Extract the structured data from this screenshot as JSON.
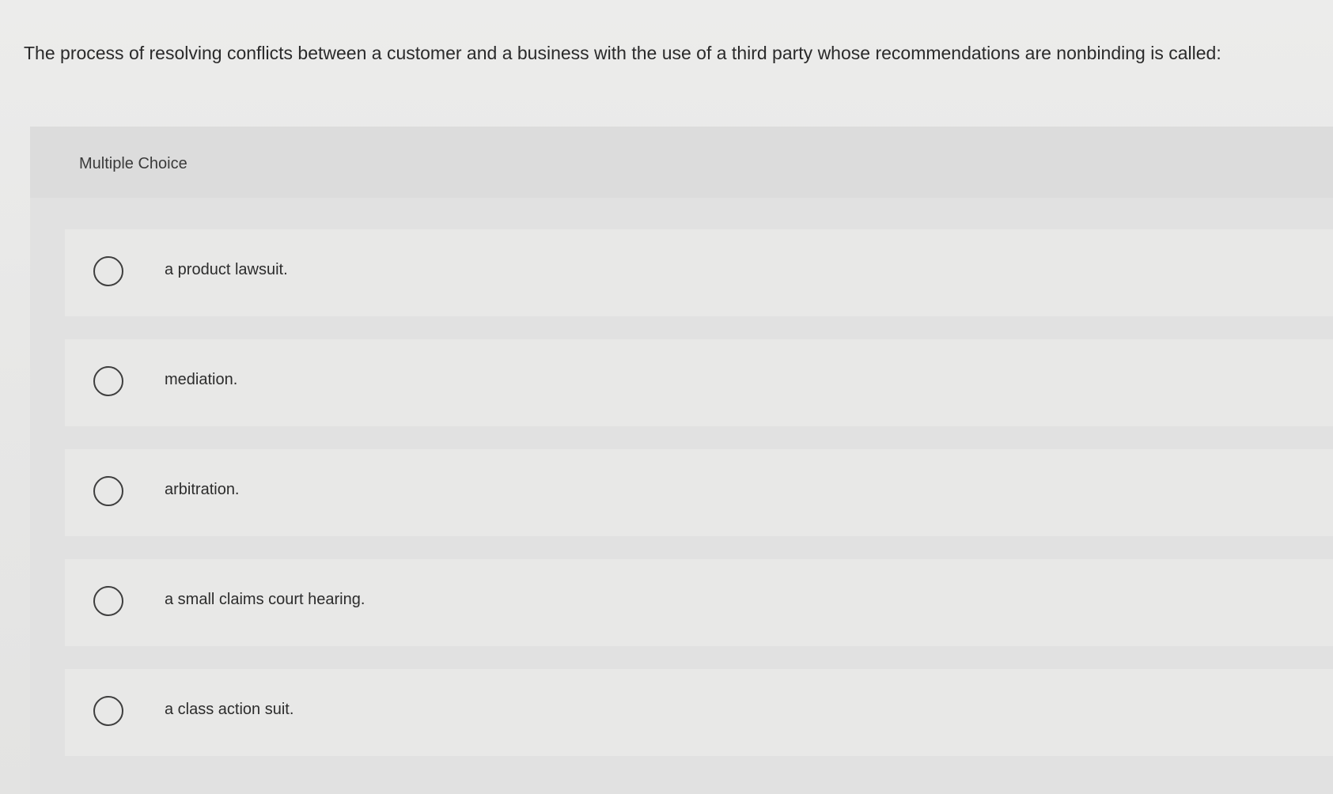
{
  "question": {
    "text": "The process of resolving conflicts between a customer and a business with the use of a third party whose recommendations are nonbinding is called:"
  },
  "panel": {
    "title": "Multiple Choice"
  },
  "options": [
    {
      "label": "a product lawsuit."
    },
    {
      "label": "mediation."
    },
    {
      "label": "arbitration."
    },
    {
      "label": "a small claims court hearing."
    },
    {
      "label": "a class action suit."
    }
  ]
}
